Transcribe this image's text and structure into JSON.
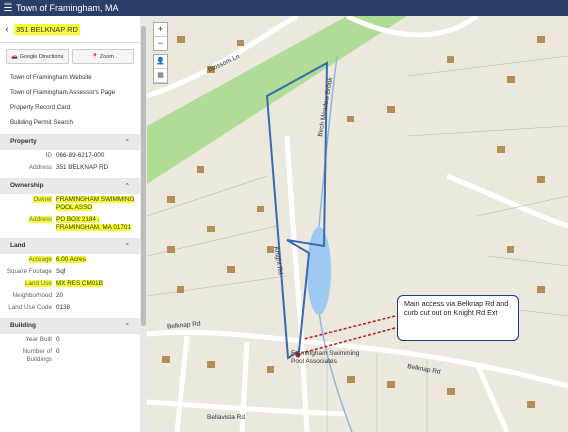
{
  "topbar": {
    "title": "Town of Framingham, MA"
  },
  "panel": {
    "address": "351 BELKNAP RD",
    "buttons": {
      "directions": "Google Directions",
      "zoom": "Zoom"
    },
    "links": [
      "Town of Framingham Website",
      "Town of Framingham Assessor's Page",
      "Property Record Card",
      "Building Permit Search"
    ],
    "property": {
      "title": "Property",
      "id_label": "ID",
      "id_value": "066-89-6217-000",
      "address_label": "Address",
      "address_value": "351 BELKNAP RD"
    },
    "ownership": {
      "title": "Ownership",
      "owner_label": "Owner",
      "owner_value": "FRAMINGHAM SWIMMING POOL ASSO",
      "address_label": "Address",
      "address_line1": "PO BOX 2184 ,",
      "address_line2": "FRAMINGHAM, MA 01701"
    },
    "land": {
      "title": "Land",
      "acreage_label": "Acreage",
      "acreage_value": "6.00 Acres",
      "sqft_label": "Square Footage",
      "sqft_value": "Sqf",
      "use_label": "Land Use",
      "use_value": "MX RES CM01B",
      "neighborhood_label": "Neighborhood",
      "neighborhood_value": "20",
      "usecode_label": "Land Use Code",
      "usecode_value": "0138"
    },
    "building": {
      "title": "Building",
      "year_label": "Year Built",
      "year_value": "0",
      "num_label": "Number of Buildings",
      "num_value": "0"
    }
  },
  "map": {
    "callout": "Main access via Belknap Rd and curb cut out on Knight Rd Ext",
    "pool_label_1": "Framingham Swimming",
    "pool_label_2": "Pool Associates",
    "roads": {
      "belknap": "Belknap Rd",
      "birch_meadow": "Birch Meadow Brook",
      "blossom": "Blossom Ln",
      "bellavista": "Bellavista Rd",
      "knight": "Knight Rd"
    }
  },
  "colors": {
    "topbar": "#2c3e66",
    "highlight": "#f7ff36",
    "parcel": "#3a6ab0",
    "pond": "#9ec9f2",
    "powerline": "#a7d98c"
  }
}
